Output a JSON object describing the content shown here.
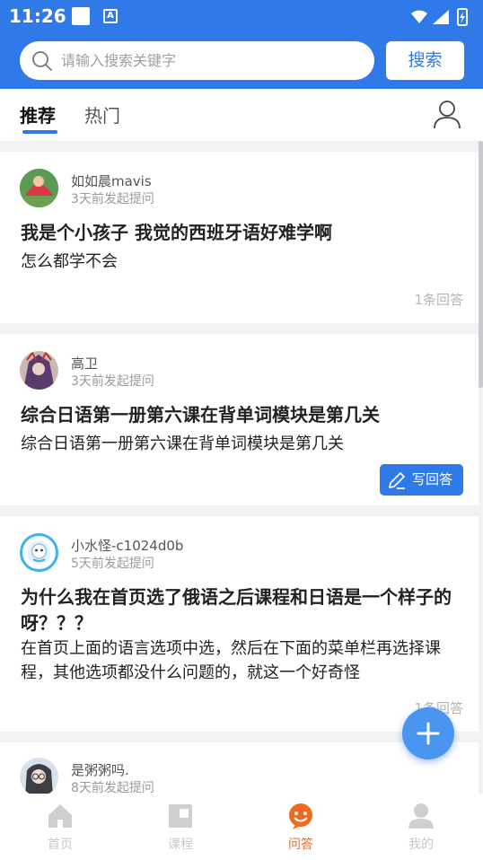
{
  "status_bar": {
    "time": "11:26"
  },
  "search": {
    "placeholder": "请输入搜索关键字",
    "button_label": "搜索"
  },
  "tabs": [
    {
      "label": "推荐",
      "active": true
    },
    {
      "label": "热门",
      "active": false
    }
  ],
  "questions": [
    {
      "user": "如如晨mavis",
      "time": "3天前发起提问",
      "title": "我是个小孩子 我觉的西班牙语好难学啊",
      "desc": "怎么都学不会",
      "answers": "1条回答"
    },
    {
      "user": "高卫",
      "time": "3天前发起提问",
      "title": "综合日语第一册第六课在背单词模块是第几关",
      "desc": "综合日语第一册第六课在背单词模块是第几关",
      "write_answer": "写回答"
    },
    {
      "user": "小水怪-c1024d0b",
      "time": "5天前发起提问",
      "title": "为什么我在首页选了俄语之后课程和日语是一个样子的呀？？？",
      "desc": "在首页上面的语言选项中选，然后在下面的菜单栏再选择课程，其他选项都没什么问题的，就这一个好奇怪",
      "answers": "1条回答"
    },
    {
      "user": "是粥粥吗.",
      "time": "8天前发起提问"
    }
  ],
  "bottom_nav": [
    {
      "label": "首页",
      "icon": "home-icon",
      "active": false
    },
    {
      "label": "课程",
      "icon": "course-icon",
      "active": false
    },
    {
      "label": "问答",
      "icon": "qa-icon",
      "active": true
    },
    {
      "label": "我的",
      "icon": "profile-icon",
      "active": false
    }
  ],
  "colors": {
    "brand": "#2f7ae8",
    "active_nav": "#ef6a1f",
    "background": "#f1f2f4"
  }
}
